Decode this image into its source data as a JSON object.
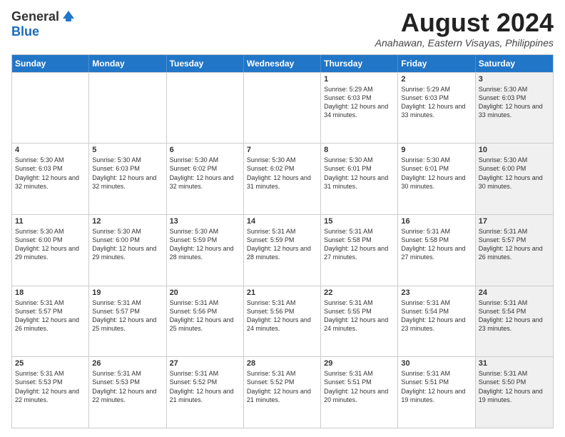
{
  "logo": {
    "general": "General",
    "blue": "Blue"
  },
  "title": {
    "month_year": "August 2024",
    "location": "Anahawan, Eastern Visayas, Philippines"
  },
  "header_days": [
    "Sunday",
    "Monday",
    "Tuesday",
    "Wednesday",
    "Thursday",
    "Friday",
    "Saturday"
  ],
  "weeks": [
    [
      {
        "day": "",
        "empty": true,
        "shaded": false
      },
      {
        "day": "",
        "empty": true,
        "shaded": false
      },
      {
        "day": "",
        "empty": true,
        "shaded": false
      },
      {
        "day": "",
        "empty": true,
        "shaded": false
      },
      {
        "day": "1",
        "sunrise": "5:29 AM",
        "sunset": "6:03 PM",
        "daylight": "12 hours and 34 minutes.",
        "shaded": false
      },
      {
        "day": "2",
        "sunrise": "5:29 AM",
        "sunset": "6:03 PM",
        "daylight": "12 hours and 33 minutes.",
        "shaded": false
      },
      {
        "day": "3",
        "sunrise": "5:30 AM",
        "sunset": "6:03 PM",
        "daylight": "12 hours and 33 minutes.",
        "shaded": true
      }
    ],
    [
      {
        "day": "4",
        "sunrise": "5:30 AM",
        "sunset": "6:03 PM",
        "daylight": "12 hours and 32 minutes.",
        "shaded": false
      },
      {
        "day": "5",
        "sunrise": "5:30 AM",
        "sunset": "6:03 PM",
        "daylight": "12 hours and 32 minutes.",
        "shaded": false
      },
      {
        "day": "6",
        "sunrise": "5:30 AM",
        "sunset": "6:02 PM",
        "daylight": "12 hours and 32 minutes.",
        "shaded": false
      },
      {
        "day": "7",
        "sunrise": "5:30 AM",
        "sunset": "6:02 PM",
        "daylight": "12 hours and 31 minutes.",
        "shaded": false
      },
      {
        "day": "8",
        "sunrise": "5:30 AM",
        "sunset": "6:01 PM",
        "daylight": "12 hours and 31 minutes.",
        "shaded": false
      },
      {
        "day": "9",
        "sunrise": "5:30 AM",
        "sunset": "6:01 PM",
        "daylight": "12 hours and 30 minutes.",
        "shaded": false
      },
      {
        "day": "10",
        "sunrise": "5:30 AM",
        "sunset": "6:00 PM",
        "daylight": "12 hours and 30 minutes.",
        "shaded": true
      }
    ],
    [
      {
        "day": "11",
        "sunrise": "5:30 AM",
        "sunset": "6:00 PM",
        "daylight": "12 hours and 29 minutes.",
        "shaded": false
      },
      {
        "day": "12",
        "sunrise": "5:30 AM",
        "sunset": "6:00 PM",
        "daylight": "12 hours and 29 minutes.",
        "shaded": false
      },
      {
        "day": "13",
        "sunrise": "5:30 AM",
        "sunset": "5:59 PM",
        "daylight": "12 hours and 28 minutes.",
        "shaded": false
      },
      {
        "day": "14",
        "sunrise": "5:31 AM",
        "sunset": "5:59 PM",
        "daylight": "12 hours and 28 minutes.",
        "shaded": false
      },
      {
        "day": "15",
        "sunrise": "5:31 AM",
        "sunset": "5:58 PM",
        "daylight": "12 hours and 27 minutes.",
        "shaded": false
      },
      {
        "day": "16",
        "sunrise": "5:31 AM",
        "sunset": "5:58 PM",
        "daylight": "12 hours and 27 minutes.",
        "shaded": false
      },
      {
        "day": "17",
        "sunrise": "5:31 AM",
        "sunset": "5:57 PM",
        "daylight": "12 hours and 26 minutes.",
        "shaded": true
      }
    ],
    [
      {
        "day": "18",
        "sunrise": "5:31 AM",
        "sunset": "5:57 PM",
        "daylight": "12 hours and 26 minutes.",
        "shaded": false
      },
      {
        "day": "19",
        "sunrise": "5:31 AM",
        "sunset": "5:57 PM",
        "daylight": "12 hours and 25 minutes.",
        "shaded": false
      },
      {
        "day": "20",
        "sunrise": "5:31 AM",
        "sunset": "5:56 PM",
        "daylight": "12 hours and 25 minutes.",
        "shaded": false
      },
      {
        "day": "21",
        "sunrise": "5:31 AM",
        "sunset": "5:56 PM",
        "daylight": "12 hours and 24 minutes.",
        "shaded": false
      },
      {
        "day": "22",
        "sunrise": "5:31 AM",
        "sunset": "5:55 PM",
        "daylight": "12 hours and 24 minutes.",
        "shaded": false
      },
      {
        "day": "23",
        "sunrise": "5:31 AM",
        "sunset": "5:54 PM",
        "daylight": "12 hours and 23 minutes.",
        "shaded": false
      },
      {
        "day": "24",
        "sunrise": "5:31 AM",
        "sunset": "5:54 PM",
        "daylight": "12 hours and 23 minutes.",
        "shaded": true
      }
    ],
    [
      {
        "day": "25",
        "sunrise": "5:31 AM",
        "sunset": "5:53 PM",
        "daylight": "12 hours and 22 minutes.",
        "shaded": false
      },
      {
        "day": "26",
        "sunrise": "5:31 AM",
        "sunset": "5:53 PM",
        "daylight": "12 hours and 22 minutes.",
        "shaded": false
      },
      {
        "day": "27",
        "sunrise": "5:31 AM",
        "sunset": "5:52 PM",
        "daylight": "12 hours and 21 minutes.",
        "shaded": false
      },
      {
        "day": "28",
        "sunrise": "5:31 AM",
        "sunset": "5:52 PM",
        "daylight": "12 hours and 21 minutes.",
        "shaded": false
      },
      {
        "day": "29",
        "sunrise": "5:31 AM",
        "sunset": "5:51 PM",
        "daylight": "12 hours and 20 minutes.",
        "shaded": false
      },
      {
        "day": "30",
        "sunrise": "5:31 AM",
        "sunset": "5:51 PM",
        "daylight": "12 hours and 19 minutes.",
        "shaded": false
      },
      {
        "day": "31",
        "sunrise": "5:31 AM",
        "sunset": "5:50 PM",
        "daylight": "12 hours and 19 minutes.",
        "shaded": true
      }
    ]
  ]
}
